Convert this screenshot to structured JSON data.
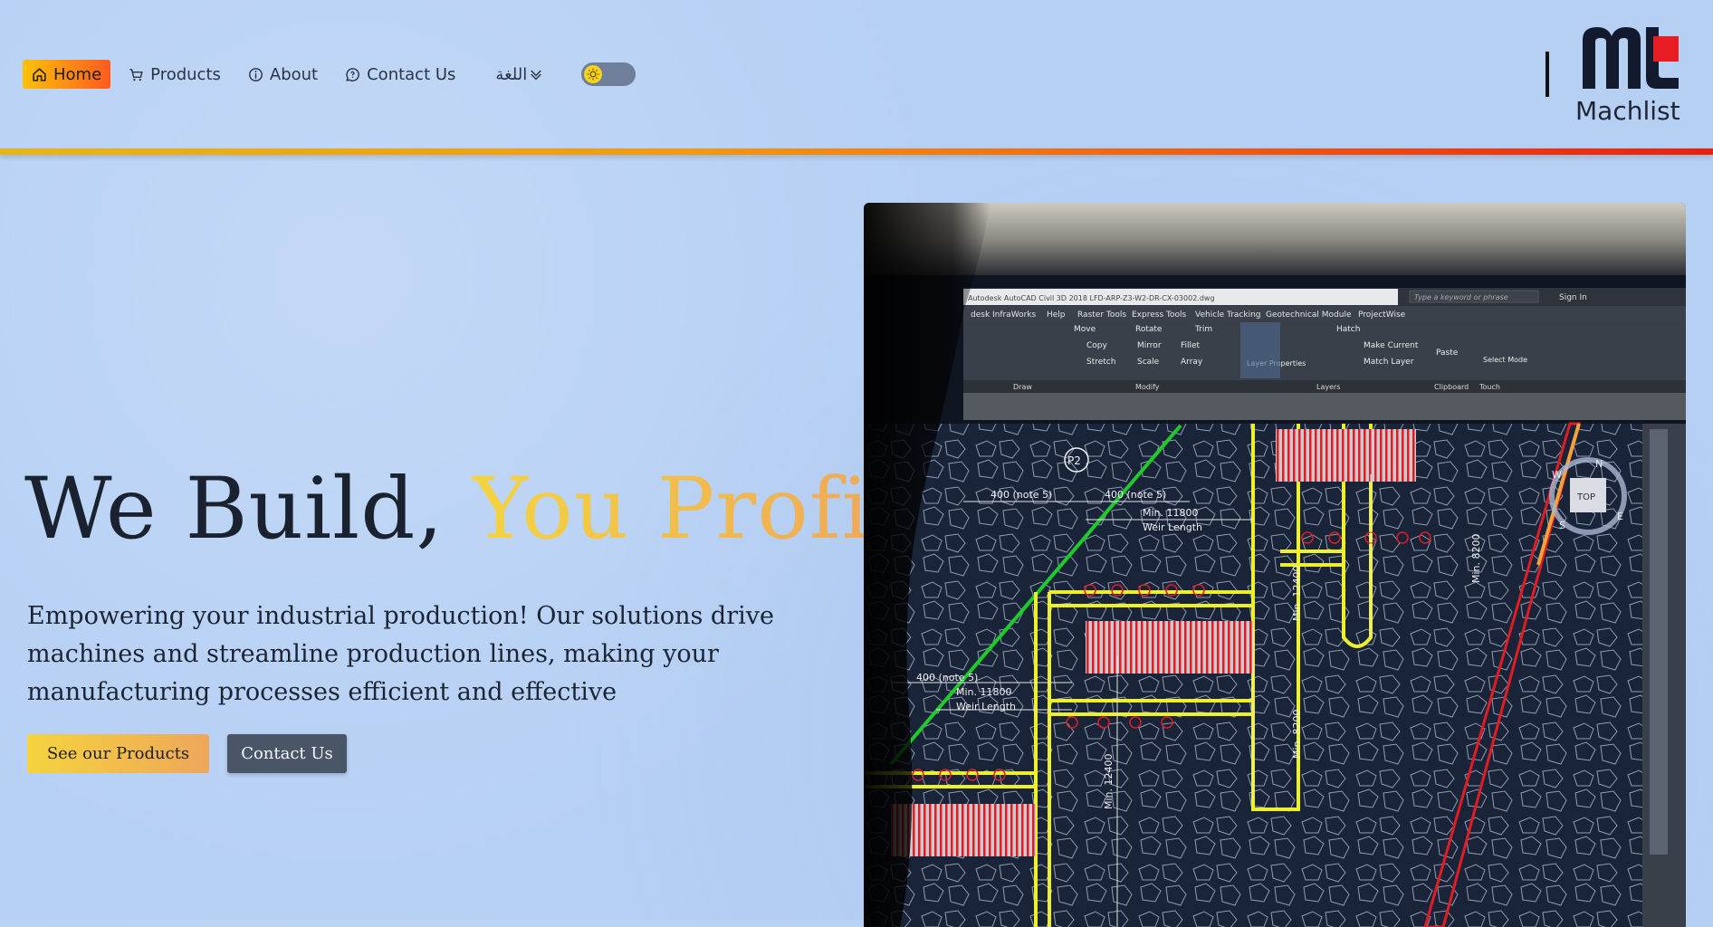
{
  "nav": {
    "items": [
      {
        "label": "Home",
        "icon": "home-icon",
        "active": true
      },
      {
        "label": "Products",
        "icon": "cart-icon",
        "active": false
      },
      {
        "label": "About",
        "icon": "info-icon",
        "active": false
      },
      {
        "label": "Contact Us",
        "icon": "chat-icon",
        "active": false
      }
    ],
    "language_label": "اللغة",
    "theme_toggle": {
      "icon": "sun-icon",
      "state": "light"
    }
  },
  "brand": {
    "name": "Machlist",
    "colors": {
      "dark": "#141a2e",
      "red": "#e81d23"
    }
  },
  "hero": {
    "title_main": "We Build,",
    "title_accent": "You Profit",
    "subtitle": "Empowering your industrial production! Our solutions drive machines and streamline production lines, making your manufacturing processes efficient and effective",
    "primary_button": "See our Products",
    "secondary_button": "Contact Us",
    "image_text": {
      "window_title": "Autodesk AutoCAD Civil 3D 2018   LFD-ARP-Z3-W2-DR-CX-03002.dwg",
      "search_placeholder": "Type a keyword or phrase",
      "sign_in": "Sign In",
      "menu": [
        "desk InfraWorks",
        "Help",
        "Raster Tools",
        "Express Tools",
        "Vehicle Tracking",
        "Geotechnical Module",
        "ProjectWise"
      ],
      "ribbon": [
        "Move",
        "Rotate",
        "Trim",
        "Copy",
        "Mirror",
        "Fillet",
        "Stretch",
        "Scale",
        "Array",
        "Layer Properties",
        "Hatch",
        "Make Current",
        "Match Layer",
        "Paste",
        "Select Mode"
      ],
      "ribbon_groups": [
        "Draw",
        "Modify",
        "Layers",
        "Clipboard",
        "Touch"
      ],
      "drawing_labels": [
        "400 (note 5)",
        "400 (note 5)",
        "Min. 11800",
        "Weir Length",
        "400 (note 5)",
        "Min. 11800",
        "Weir Length",
        "Min. 12400",
        "Min. 8200",
        "Min. 8200",
        "Min. 12400",
        "P2",
        "TOP",
        "N",
        "W",
        "S",
        "E"
      ]
    }
  },
  "colors": {
    "accent_start": "#f5d43e",
    "accent_end": "#eea65a",
    "nav_line_start": "#e7b612",
    "nav_line_end": "#e8200e",
    "secondary_button": "#4a5568"
  }
}
